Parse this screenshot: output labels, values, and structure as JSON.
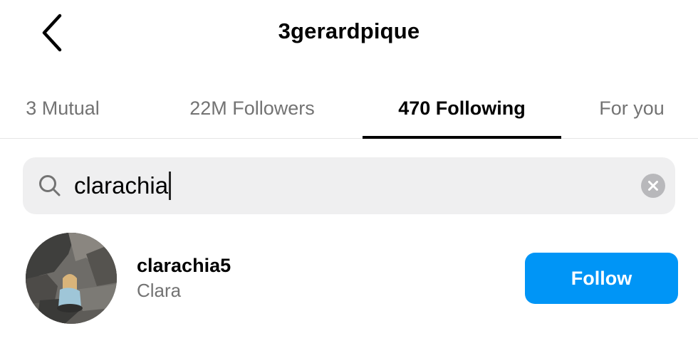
{
  "header": {
    "title": "3gerardpique",
    "back_icon": "chevron-left-icon"
  },
  "tabs": [
    {
      "label": "3 Mutual",
      "active": false
    },
    {
      "label": "22M Followers",
      "active": false
    },
    {
      "label": "470 Following",
      "active": true
    },
    {
      "label": "For you",
      "active": false
    }
  ],
  "search": {
    "value": "clarachia",
    "icon": "search-icon",
    "clear_icon": "clear-icon"
  },
  "results": [
    {
      "username": "clarachia5",
      "full_name": "Clara",
      "button_label": "Follow"
    }
  ],
  "colors": {
    "accent": "#0095f6",
    "secondary_text": "#737373",
    "search_bg": "#efeff0"
  }
}
